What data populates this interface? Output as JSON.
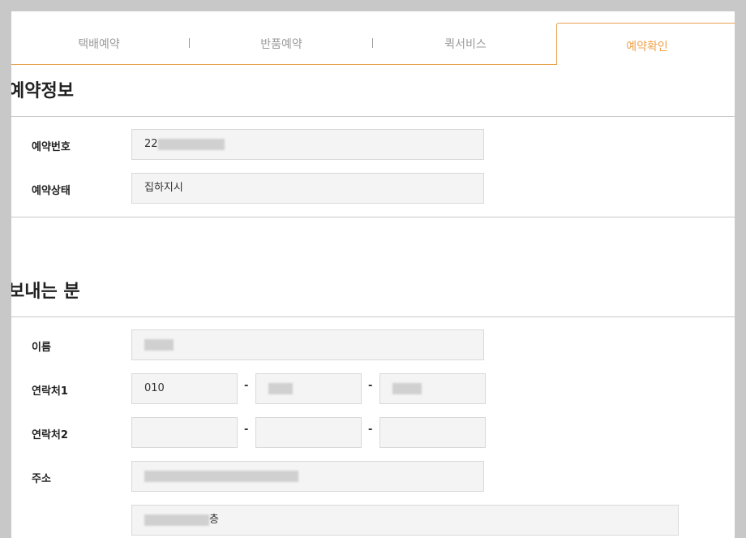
{
  "tabs": {
    "items": [
      "택배예약",
      "반품예약",
      "퀵서비스"
    ],
    "active": "예약확인"
  },
  "reservation": {
    "title": "예약정보",
    "number_label": "예약번호",
    "number_value": "22",
    "status_label": "예약상태",
    "status_value": "집하지시"
  },
  "sender": {
    "title": "보내는 분",
    "name_label": "이름",
    "phone1_label": "연락처1",
    "phone1_part1": "010",
    "phone2_label": "연락처2",
    "address_label": "주소",
    "dash": "-",
    "address_detail_suffix": "층"
  },
  "colors": {
    "accent": "#f0a14a",
    "field_bg": "#f4f4f4",
    "border": "#d9d9d9"
  }
}
